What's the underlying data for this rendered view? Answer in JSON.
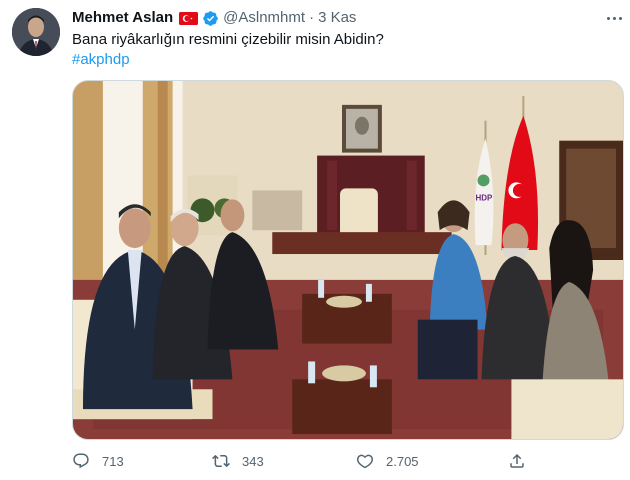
{
  "tweet": {
    "author_name": "Mehmet Aslan",
    "handle": "@Aslnmhmt",
    "separator": "·",
    "time": "3 Kas",
    "text": "Bana riyâkarlığın resmini çizebilir misin Abidin?",
    "hashtag": "#akphdp"
  },
  "photo": {
    "flag_label": "HDP",
    "background_colors": {
      "wall": "#e8dcc4",
      "carpet": "#8a3c38",
      "flag": "#e30a17"
    }
  },
  "actions": {
    "replies": "713",
    "retweets": "343",
    "likes": "2.705"
  },
  "icons": {
    "country_flag": "turkey-flag-icon",
    "verified": "verified-badge-icon",
    "more": "more-options-icon",
    "reply": "reply-icon",
    "retweet": "retweet-icon",
    "like": "heart-icon",
    "share": "share-icon"
  },
  "colors": {
    "accent": "#1d9bf0",
    "muted": "#536471",
    "text": "#0f1419"
  }
}
